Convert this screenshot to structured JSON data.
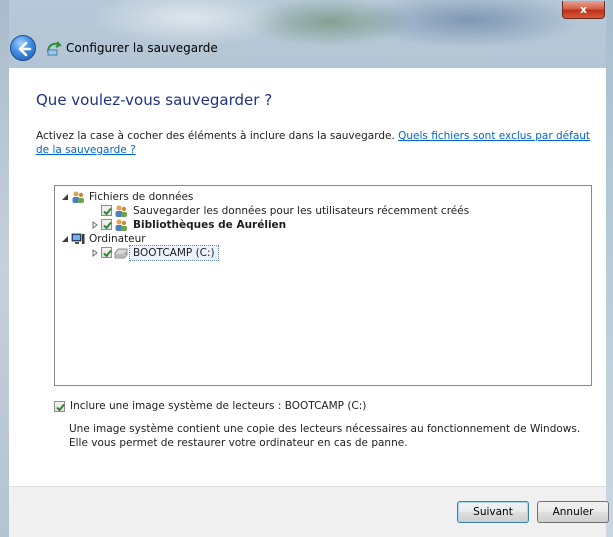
{
  "window": {
    "title": "Configurer la sauvegarde",
    "close_glyph": "x"
  },
  "page": {
    "heading": "Que voulez-vous sauvegarder ?",
    "intro_text": "Activez la case à cocher des éléments à inclure dans la sauvegarde. ",
    "intro_link": "Quels fichiers sont exclus par défaut de la sauvegarde ?"
  },
  "tree": {
    "items": [
      {
        "label": "Fichiers de données",
        "checked": null,
        "icon": "users-icon"
      },
      {
        "label": "Sauvegarder les données pour les utilisateurs récemment créés",
        "checked": true,
        "icon": "users-icon"
      },
      {
        "label": "Bibliothèques de Aurélien",
        "checked": true,
        "icon": "users-icon"
      },
      {
        "label": "Ordinateur",
        "checked": null,
        "icon": "computer-icon"
      },
      {
        "label": "BOOTCAMP (C:)",
        "checked": true,
        "icon": "drive-icon"
      }
    ]
  },
  "system_image": {
    "checked": true,
    "label": "Inclure une image système de lecteurs : BOOTCAMP (C:)",
    "description": "Une image système contient une copie des lecteurs nécessaires au fonctionnement de Windows. Elle vous permet de restaurer votre ordinateur en cas de panne."
  },
  "buttons": {
    "next": "Suivant",
    "cancel": "Annuler"
  }
}
